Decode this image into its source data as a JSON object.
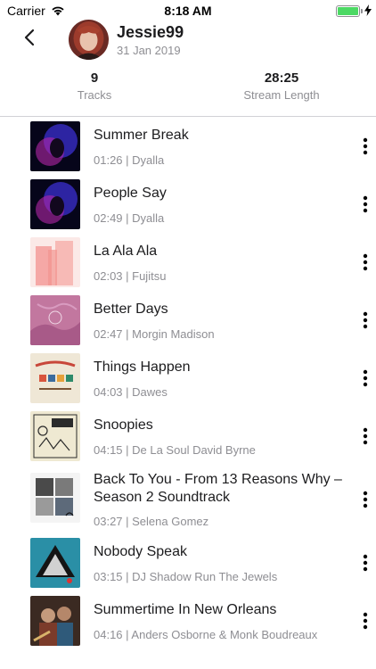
{
  "status": {
    "carrier": "Carrier",
    "time": "8:18 AM",
    "battery_percent": 100
  },
  "profile": {
    "name": "Jessie99",
    "joined": "31 Jan 2019"
  },
  "stats": [
    {
      "value": "9",
      "label": "Tracks"
    },
    {
      "value": "28:25",
      "label": "Stream Length"
    }
  ],
  "tracks": [
    {
      "title": "Summer Break",
      "meta": "01:26 | Dyalla"
    },
    {
      "title": "People Say",
      "meta": "02:49 | Dyalla"
    },
    {
      "title": "La Ala Ala",
      "meta": "02:03 | Fujitsu"
    },
    {
      "title": "Better Days",
      "meta": "02:47 | Morgin Madison"
    },
    {
      "title": "Things Happen",
      "meta": "04:03 | Dawes"
    },
    {
      "title": "Snoopies",
      "meta": "04:15 | De La Soul David Byrne"
    },
    {
      "title": "Back To You - From 13 Reasons Why – Season 2 Soundtrack",
      "meta": "03:27 | Selena Gomez"
    },
    {
      "title": "Nobody Speak",
      "meta": "03:15 | DJ Shadow Run The Jewels"
    },
    {
      "title": "Summertime In New Orleans",
      "meta": "04:16 | Anders Osborne & Monk Boudreaux"
    }
  ],
  "colors": {
    "text": "#1c1c1e",
    "secondary": "#8e8e93",
    "divider": "#d1d1d6",
    "battery": "#4cd964"
  },
  "icons": {
    "back": "chevron-left-icon",
    "more": "vertical-ellipsis-icon",
    "wifi": "wifi-icon",
    "battery": "battery-icon",
    "charging": "bolt-icon"
  }
}
